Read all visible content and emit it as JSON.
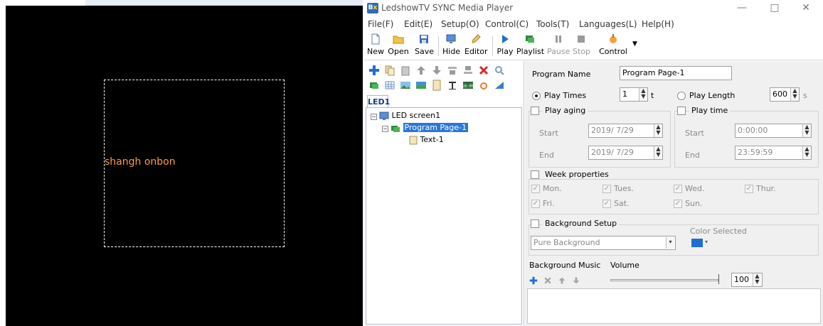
{
  "preview": {
    "text": "shangh onbon",
    "text_color": "#ff9a3c",
    "background": "#000000"
  },
  "window": {
    "title": "LedshowTV SYNC Media Player",
    "minimize_label": "—",
    "maximize_label": "□",
    "close_label": "✕"
  },
  "menu": [
    "File(F)",
    "Edit(E)",
    "Setup(O)",
    "Control(C)",
    "Tools(T)",
    "Languages(L)",
    "Help(H)"
  ],
  "toolbar": {
    "new": "New",
    "open": "Open",
    "save": "Save",
    "hide": "Hide",
    "editor": "Editor",
    "play": "Play",
    "playlist": "Playlist",
    "pause": "Pause",
    "stop": "Stop",
    "control": "Control"
  },
  "tabs": {
    "led1": "LED1"
  },
  "tree": {
    "screen": "LED screen1",
    "program": "Program Page-1",
    "text_item": "Text-1"
  },
  "program": {
    "name_label": "Program Name",
    "name_value": "Program Page-1",
    "play_times_label": "Play Times",
    "play_times_value": "1",
    "play_times_unit": "t",
    "play_length_label": "Play Length",
    "play_length_value": "600",
    "play_length_unit": "s",
    "play_aging_label": "Play aging",
    "aging_start_label": "Start",
    "aging_start_value": "2019/ 7/29",
    "aging_end_label": "End",
    "aging_end_value": "2019/ 7/29",
    "play_time_label": "Play time",
    "time_start_label": "Start",
    "time_start_value": "0:00:00",
    "time_end_label": "End",
    "time_end_value": "23:59:59",
    "week_label": "Week properties",
    "days": [
      "Mon.",
      "Tues.",
      "Wed.",
      "Thur.",
      "Fri.",
      "Sat.",
      "Sun."
    ],
    "bg_setup_label": "Background Setup",
    "bg_type_value": "Pure Background",
    "color_selected_label": "Color Selected",
    "color_selected": "#1f6fd1",
    "bg_music_label": "Background Music",
    "volume_label": "Volume",
    "volume_value": "100"
  }
}
